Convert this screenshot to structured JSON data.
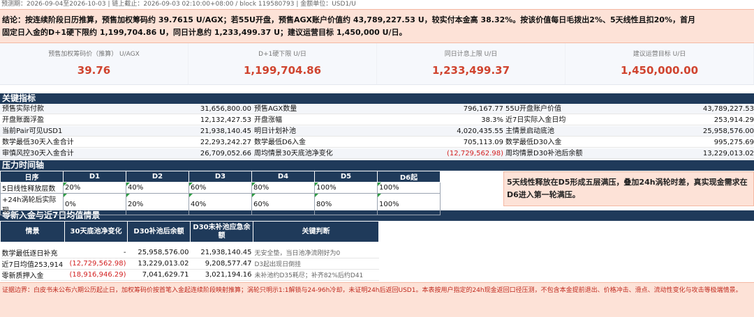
{
  "meta": {
    "text": "预测期：2026-09-04至2026-10-03 | 链上截止：2026-09-03 02:10:00+08:00 / block 119580793 | 金额单位：USD1/U"
  },
  "conclusion": {
    "line1": "结论：按连续阶段日历推算，预售加权筹码约 39.7615 U/AGX；若55U开盘，预售AGX账户价值约 43,789,227.53 U，较实付本金高 38.32%。按该价值每日毛拨出2%、5天线性且扣20%，首月",
    "line2": "固定日入金的D+1硬下限约 1,199,704.86 U，同日计息约 1,233,499.37 U；建议运营目标 1,450,000 U/日。"
  },
  "kpis": [
    {
      "label": "预售加权筹码价（推算） U/AGX",
      "value": "39.76"
    },
    {
      "label": "D+1硬下限 U/日",
      "value": "1,199,704.86"
    },
    {
      "label": "同日计息上限 U/日",
      "value": "1,233,499.37"
    },
    {
      "label": "建议运营目标 U/日",
      "value": "1,450,000.00"
    }
  ],
  "sections": {
    "key_metrics": "关键指标",
    "pressure": "压力时间轴",
    "inflow": "零新入金与近7日均值情景"
  },
  "metrics": [
    [
      {
        "label": "预售实际付款",
        "value": "31,656,800.00"
      },
      {
        "label": "预售AGX数量",
        "value": "796,167.77"
      },
      {
        "label": "55U开盘账户价值",
        "value": "43,789,227.53"
      }
    ],
    [
      {
        "label": "开盘账面浮盈",
        "value": "12,132,427.53"
      },
      {
        "label": "开盘涨幅",
        "value": "38.3%"
      },
      {
        "label": "近7日实际入金日均",
        "value": "253,914.29"
      }
    ],
    [
      {
        "label": "当前Pair可见USD1",
        "value": "21,938,140.45"
      },
      {
        "label": "明日计划补池",
        "value": "4,020,435.55"
      },
      {
        "label": "主情景启动底池",
        "value": "25,958,576.00"
      }
    ],
    [
      {
        "label": "数学最低30天入金合计",
        "value": "22,293,242.27"
      },
      {
        "label": "数学最低D6入金",
        "value": "705,113.09"
      },
      {
        "label": "数学最低D30入金",
        "value": "995,275.69"
      }
    ],
    [
      {
        "label": "审慎风控30天入金合计",
        "value": "26,709,052.66"
      },
      {
        "label": "周均情景30天底池净变化",
        "value": "(12,729,562.98)"
      },
      {
        "label": "周均情景D30补池后余额",
        "value": "13,229,013.02"
      }
    ]
  ],
  "pressure": {
    "headers": [
      "日序",
      "D1",
      "D2",
      "D3",
      "D4",
      "D5",
      "D6起"
    ],
    "rows": [
      [
        "5日线性释放层数",
        "20%",
        "40%",
        "60%",
        "80%",
        "100%",
        "100%"
      ],
      [
        "+24h涡轮后实际现",
        "0%",
        "20%",
        "40%",
        "60%",
        "80%",
        "100%"
      ]
    ],
    "callout": "5天线性释放在D5形成五层满压，叠加24h涡轮时差，真实现金需求在D6进入第一轮满压。"
  },
  "inflow": {
    "headers": [
      "情景",
      "30天底池净变化",
      "D30补池后余额",
      "D30未补池应急余额",
      "关键判断"
    ],
    "rows": [
      [
        "数学最低逐日补充",
        "-",
        "25,958,576.00",
        "21,938,140.45",
        "无安全垫，当日池净流刚好为0"
      ],
      [
        "近7日均值253,914",
        "(12,729,562.98)",
        "13,229,013.02",
        "9,208,577.47",
        "D3起出现日倒挂"
      ],
      [
        "零新质押入金",
        "(18,916,946.29)",
        "7,041,629.71",
        "3,021,194.16",
        "未补池约D35耗尽；补齐82%后约D41"
      ]
    ]
  },
  "boundary": "证据边界：白皮书未公布六期公历起止日，加权筹码价按首笔入金起连续阶段映射推算；涡轮只明示1:1解锁与24-96h冷却，未证明24h后返回USD1。本表按用户指定的24h现金返回口径压测，不包含本金提前退出、价格冲击、滑点、流动性变化与攻击等极端情景。"
}
